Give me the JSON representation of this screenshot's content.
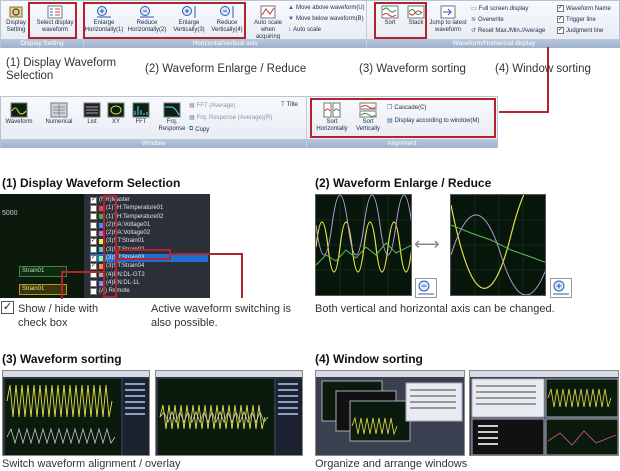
{
  "ribbon1": {
    "groups": {
      "display_setting": "Display Setting",
      "hv_axis": "Horizontal/vertical axis",
      "wave_num": "Waveform/Numerical display"
    },
    "buttons": {
      "display_setting": "Display Setting",
      "select_display": "Select display waveform",
      "enl_h": "Enlarge Horizontally(1)",
      "red_h": "Reduce Horizontally(2)",
      "enl_v": "Enlarge Vertically(3)",
      "red_v": "Reduce Vertically(4)",
      "auto_scale_acq": "Auto scale when acquiring",
      "sort": "Sort",
      "stack": "Stack",
      "jump_latest": "Jump to latest waveform"
    },
    "small": {
      "move_above": "Move above waveform(U)",
      "move_below": "Move below waveform(B)",
      "auto_scale": "Auto scale",
      "full_screen": "Full screen display",
      "overwrite": "Overwrite",
      "reset_max": "Reset Max./Min./Average",
      "wave_name": "Waveform Name",
      "trigger_line": "Trigger line",
      "judgment_line": "Judgment line"
    }
  },
  "captions": {
    "c1": "(1) Display Waveform Selection",
    "c2": "(2) Waveform Enlarge / Reduce",
    "c3": "(3) Waveform sorting",
    "c4": "(4) Window sorting"
  },
  "ribbon2": {
    "groups": {
      "window": "Window",
      "alignment": "Alignment"
    },
    "buttons": {
      "waveform": "Waveform",
      "numerical": "Numerical",
      "list": "List",
      "xy": "XY",
      "fft": "FFT",
      "frq": "Frq. Response",
      "sort_h": "Sort Horizontally",
      "sort_v": "Sort Vertically"
    },
    "small": {
      "fft_avg": "FFT (Average)",
      "frq_avg": "Frq. Response (Average)(R)",
      "copy": "Copy",
      "title": "Title",
      "cascade": "Cascade(C)",
      "by_window": "Display according to window(M)"
    }
  },
  "sections": {
    "s1": {
      "title": "(1) Display Waveform Selection",
      "axis_num": "5000",
      "box1": "Strain01",
      "box2": "Strain01",
      "note_left": "Show / hide with check box",
      "note_right": "Active waveform switching is also possible.",
      "check_mark": "✓",
      "tree": [
        "(NR)Master",
        "(1)TH:Temperature01",
        "(1)TH:Temperature02",
        "(2)HA:Voltage01",
        "(2)HA:Voltage02",
        "(3)ST:Strain01",
        "(3)ST:Strain02",
        "(3)ST:Strain03",
        "(3)ST:Strain04",
        "(4)EN:DL-GT2",
        "(4)EN:DL-1L",
        "(A) Remote"
      ]
    },
    "s2": {
      "title": "(2) Waveform Enlarge / Reduce",
      "note": "Both vertical and horizontal axis can be changed."
    },
    "s3": {
      "title": "(3) Waveform sorting",
      "note": "Switch waveform alignment / overlay"
    },
    "s4": {
      "title": "(4) Window sorting",
      "note": "Organize and arrange windows"
    }
  },
  "colors": {
    "highlight": "#b3232e",
    "ribbon_group": "#a9bbd3",
    "plot_bg": "#06160a"
  }
}
